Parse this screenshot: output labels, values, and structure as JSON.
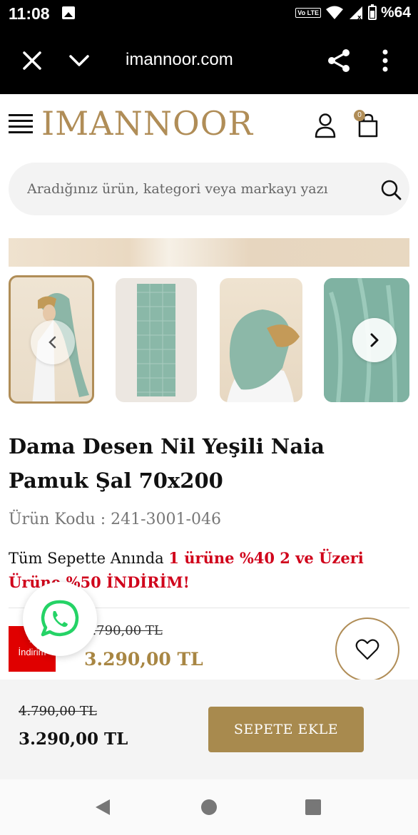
{
  "status_bar": {
    "time": "11:08",
    "volte": "Vo LTE",
    "battery": "%64"
  },
  "browser": {
    "url": "imannoor.com"
  },
  "header": {
    "logo": "IMANNOOR",
    "cart_count": "0"
  },
  "search": {
    "placeholder": "Aradığınız ürün, kategori veya markayı yazı"
  },
  "product": {
    "title": "Dama Desen Nil Yeşili Naia Pamuk Şal 70x200",
    "code_label": "Ürün Kodu : 241-3001-046",
    "promo_prefix": "Tüm Sepette Anında ",
    "promo_highlight": "1 ürüne %40 2 ve Üzeri Ürüne %50 İNDİRİM!",
    "discount_badge_top": "%",
    "discount_badge_bottom": "İndirim",
    "old_price": "4.790,00 TL",
    "new_price": "3.290,00 TL"
  },
  "sticky": {
    "old_price": "4.790,00 TL",
    "new_price": "3.290,00 TL",
    "add_to_cart": "SEPETE EKLE"
  },
  "colors": {
    "brand_gold": "#b08d57",
    "button_gold": "#a88a4e",
    "promo_red": "#d0021b",
    "scarf_green": "#7fb2a2"
  }
}
